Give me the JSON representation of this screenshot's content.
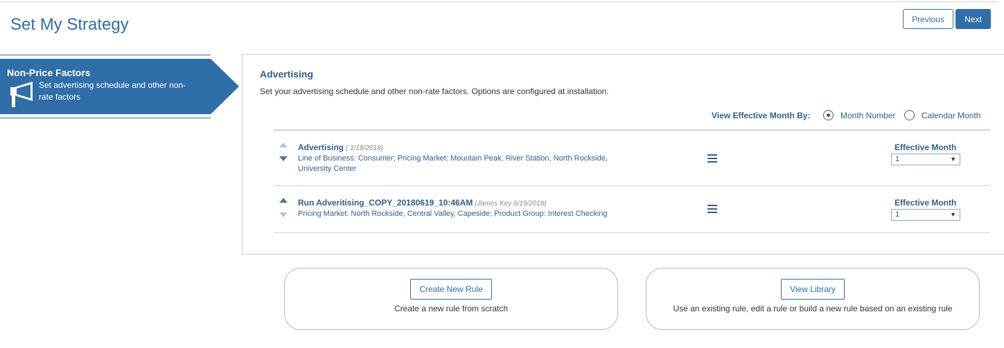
{
  "page": {
    "title": "Set My Strategy",
    "previous_label": "Previous",
    "next_label": "Next"
  },
  "step": {
    "title": "Non-Price Factors",
    "description": "Set advertising schedule and other non-rate factors",
    "icon": "megaphone-icon",
    "color": "#2f6ea8"
  },
  "section": {
    "title": "Advertising",
    "description": "Set your advertising schedule and other non-rate factors. Options are configured at installation.",
    "view_by_label": "View Effective Month By:",
    "options": [
      {
        "label": "Month Number",
        "selected": true
      },
      {
        "label": "Calendar Month",
        "selected": false
      }
    ]
  },
  "rules": [
    {
      "name": "Advertising",
      "meta": "( 1/18/2018)",
      "detail": "Line of Business: Consumer; Pricing Market: Mountain Peak, River Station, North Rockside, University Center",
      "effective_label": "Effective Month",
      "effective_value": "1"
    },
    {
      "name": "Run Adveritising_COPY_20180619_10:46AM",
      "meta": "(James Key 6/19/2018)",
      "detail": "Pricing Market: North Rockside, Central Valley, Capeside; Product Group: Interest Checking",
      "effective_label": "Effective Month",
      "effective_value": "1"
    }
  ],
  "cards": [
    {
      "button": "Create New Rule",
      "text": "Create a new rule from scratch"
    },
    {
      "button": "View Library",
      "text": "Use an existing rule, edit a rule or build a new rule based on an existing rule"
    }
  ]
}
